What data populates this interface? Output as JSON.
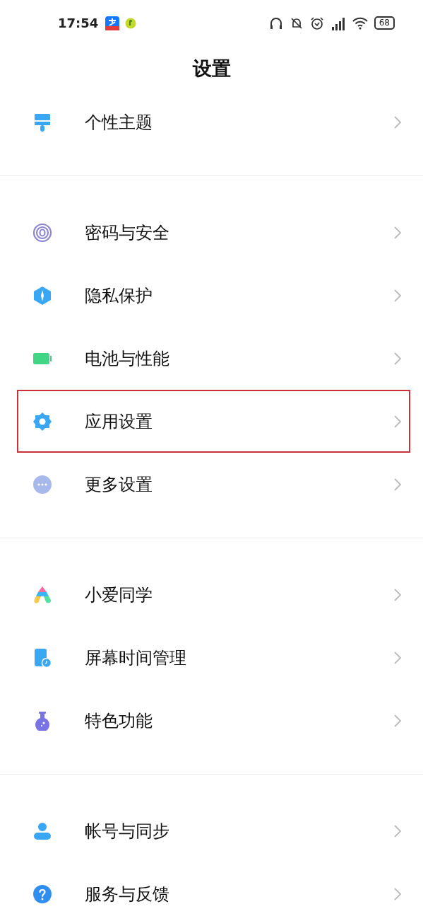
{
  "status_bar": {
    "time": "17:54",
    "battery": "68"
  },
  "title": "设置",
  "groups": [
    {
      "items": [
        {
          "label": "个性主题",
          "highlighted": false
        }
      ]
    },
    {
      "items": [
        {
          "label": "密码与安全",
          "highlighted": false
        },
        {
          "label": "隐私保护",
          "highlighted": false
        },
        {
          "label": "电池与性能",
          "highlighted": false
        },
        {
          "label": "应用设置",
          "highlighted": true
        },
        {
          "label": "更多设置",
          "highlighted": false
        }
      ]
    },
    {
      "items": [
        {
          "label": "小爱同学",
          "highlighted": false
        },
        {
          "label": "屏幕时间管理",
          "highlighted": false
        },
        {
          "label": "特色功能",
          "highlighted": false
        }
      ]
    },
    {
      "items": [
        {
          "label": "帐号与同步",
          "highlighted": false
        },
        {
          "label": "服务与反馈",
          "highlighted": false
        }
      ]
    }
  ]
}
